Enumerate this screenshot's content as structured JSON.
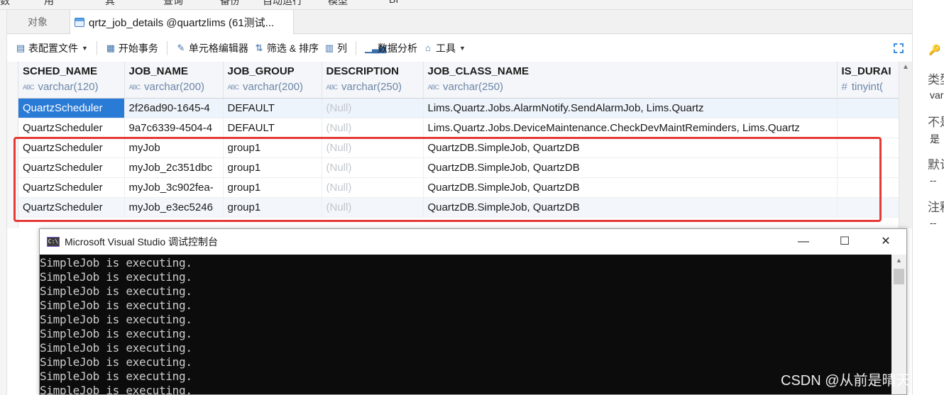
{
  "menu": [
    "数",
    "用",
    "其",
    "查询",
    "备份",
    "自动运行",
    "模型",
    "BI"
  ],
  "tabs": {
    "objects_label": "对象",
    "active_label": "qrtz_job_details @quartzlims (61测试..."
  },
  "toolbar": {
    "table_config": "表配置文件",
    "begin_transaction": "开始事务",
    "cell_editor": "单元格编辑器",
    "filter_sort": "筛选 & 排序",
    "columns": "列",
    "data_analysis": "数据分析",
    "tools": "工具"
  },
  "grid": {
    "columns": [
      {
        "name": "SCHED_NAME",
        "type": "varchar(120)",
        "type_icon": "text-type-icon"
      },
      {
        "name": "JOB_NAME",
        "type": "varchar(200)",
        "type_icon": "text-type-icon"
      },
      {
        "name": "JOB_GROUP",
        "type": "varchar(200)",
        "type_icon": "text-type-icon"
      },
      {
        "name": "DESCRIPTION",
        "type": "varchar(250)",
        "type_icon": "text-type-icon"
      },
      {
        "name": "JOB_CLASS_NAME",
        "type": "varchar(250)",
        "type_icon": "text-type-icon"
      },
      {
        "name": "IS_DURAI",
        "type": "tinyint(",
        "type_icon": "number-type-icon"
      }
    ],
    "rows": [
      [
        "QuartzScheduler",
        "2f26ad90-1645-4",
        "DEFAULT",
        "(Null)",
        "Lims.Quartz.Jobs.AlarmNotify.SendAlarmJob, Lims.Quartz",
        ""
      ],
      [
        "QuartzScheduler",
        "9a7c6339-4504-4",
        "DEFAULT",
        "(Null)",
        "Lims.Quartz.Jobs.DeviceMaintenance.CheckDevMaintReminders, Lims.Quartz",
        ""
      ],
      [
        "QuartzScheduler",
        "myJob",
        "group1",
        "(Null)",
        "QuartzDB.SimpleJob, QuartzDB",
        ""
      ],
      [
        "QuartzScheduler",
        "myJob_2c351dbc",
        "group1",
        "(Null)",
        "QuartzDB.SimpleJob, QuartzDB",
        ""
      ],
      [
        "QuartzScheduler",
        "myJob_3c902fea-",
        "group1",
        "(Null)",
        "QuartzDB.SimpleJob, QuartzDB",
        ""
      ],
      [
        "QuartzScheduler",
        "myJob_e3ec5246",
        "group1",
        "(Null)",
        "QuartzDB.SimpleJob, QuartzDB",
        ""
      ]
    ],
    "selected_row": 0
  },
  "right_panel": {
    "type_label": "类型",
    "type_value": "var",
    "not_null_label": "不是",
    "not_null_value": "是",
    "default_label": "默认",
    "default_value": "--",
    "comment_label": "注释",
    "comment_value": "--"
  },
  "console": {
    "title": "Microsoft Visual Studio 调试控制台",
    "icon_text": "C:\\",
    "lines": [
      "SimpleJob is executing.",
      "SimpleJob is executing.",
      "SimpleJob is executing.",
      "SimpleJob is executing.",
      "SimpleJob is executing.",
      "SimpleJob is executing.",
      "SimpleJob is executing.",
      "SimpleJob is executing.",
      "SimpleJob is executing.",
      "SimpleJob is executing."
    ]
  },
  "watermark": "CSDN @从前是晴天",
  "colors": {
    "selection": "#2a7bd6",
    "highlight_box": "#e53935",
    "null_text": "#c2c6cc",
    "console_bg": "#0c0c0c"
  }
}
